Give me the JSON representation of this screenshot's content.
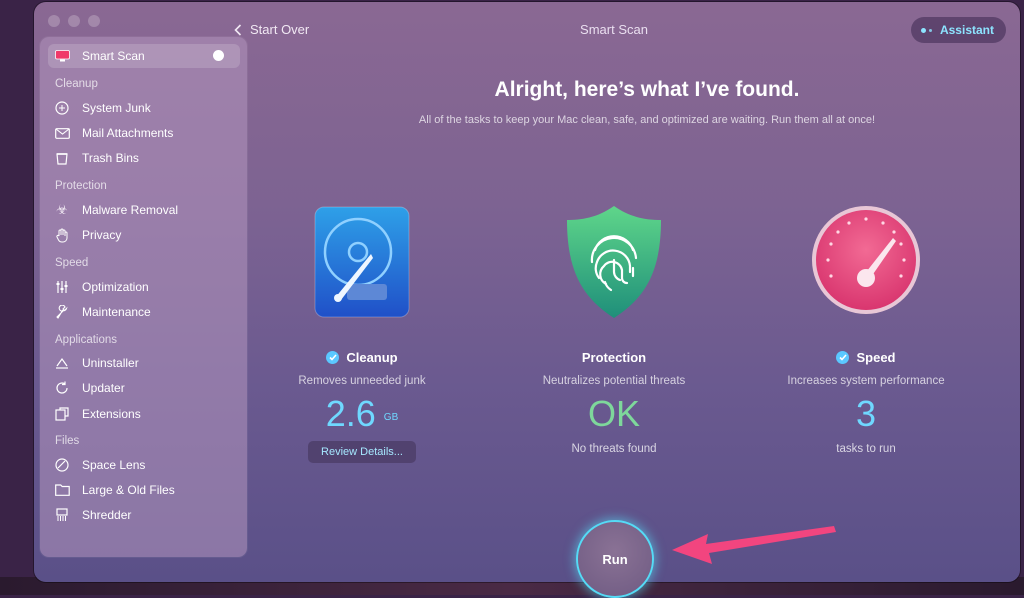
{
  "window": {
    "start_over_label": "Start Over",
    "title": "Smart Scan",
    "assistant_label": "Assistant"
  },
  "sidebar": {
    "active_item": "Smart Scan",
    "sections": [
      {
        "heading": "Cleanup",
        "items": [
          "System Junk",
          "Mail Attachments",
          "Trash Bins"
        ]
      },
      {
        "heading": "Protection",
        "items": [
          "Malware Removal",
          "Privacy"
        ]
      },
      {
        "heading": "Speed",
        "items": [
          "Optimization",
          "Maintenance"
        ]
      },
      {
        "heading": "Applications",
        "items": [
          "Uninstaller",
          "Updater",
          "Extensions"
        ]
      },
      {
        "heading": "Files",
        "items": [
          "Space Lens",
          "Large & Old Files",
          "Shredder"
        ]
      }
    ]
  },
  "main": {
    "heading": "Alright, here’s what I’ve found.",
    "subheading": "All of the tasks to keep your Mac clean, safe, and optimized are waiting. Run them all at once!",
    "cleanup": {
      "title": "Cleanup",
      "description": "Removes unneeded junk",
      "value": "2.6",
      "unit": "GB",
      "button": "Review Details..."
    },
    "protection": {
      "title": "Protection",
      "description": "Neutralizes potential threats",
      "value": "OK",
      "note": "No threats found"
    },
    "speed": {
      "title": "Speed",
      "description": "Increases system performance",
      "value": "3",
      "note": "tasks to run"
    },
    "run_label": "Run"
  },
  "colors": {
    "accent_cyan": "#6fd8ff",
    "ok_green": "#7ed79b",
    "arrow_pink": "#f2457f"
  }
}
